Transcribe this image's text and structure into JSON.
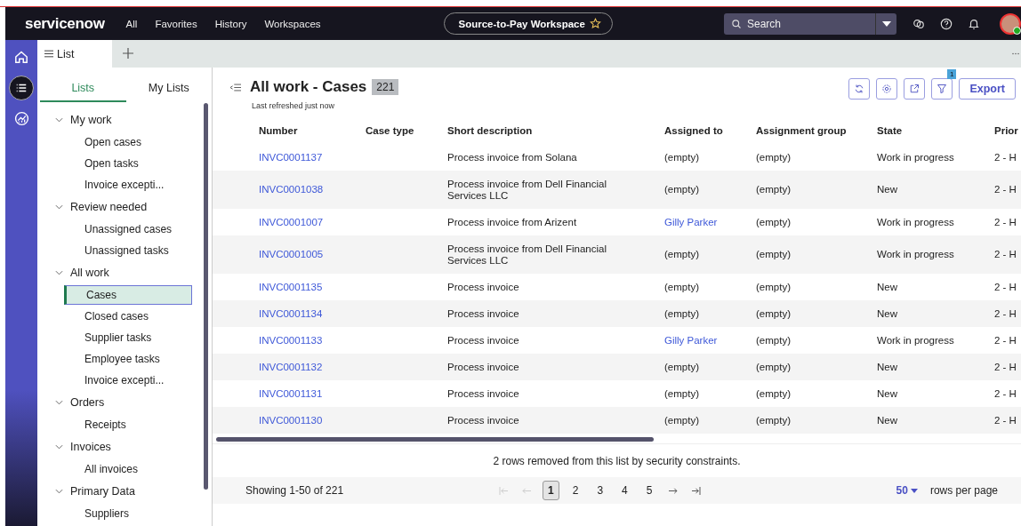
{
  "header": {
    "logo": "servicenow",
    "nav": [
      "All",
      "Favorites",
      "History",
      "Workspaces"
    ],
    "workspace": "Source-to-Pay Workspace",
    "search": {
      "placeholder": "Search"
    }
  },
  "page_tabs": [
    {
      "label": "List",
      "selected": true
    }
  ],
  "panel": {
    "tabs": [
      {
        "label": "Lists",
        "selected": true
      },
      {
        "label": "My Lists",
        "selected": false
      }
    ],
    "groups": [
      {
        "label": "My work",
        "expanded": true,
        "children": [
          {
            "label": "Open cases",
            "selected": false
          },
          {
            "label": "Open tasks",
            "selected": false
          },
          {
            "label": "Invoice excepti...",
            "selected": false
          }
        ]
      },
      {
        "label": "Review needed",
        "expanded": true,
        "children": [
          {
            "label": "Unassigned cases",
            "selected": false
          },
          {
            "label": "Unassigned tasks",
            "selected": false
          }
        ]
      },
      {
        "label": "All work",
        "expanded": true,
        "children": [
          {
            "label": "Cases",
            "selected": true
          },
          {
            "label": "Closed cases",
            "selected": false
          },
          {
            "label": "Supplier tasks",
            "selected": false
          },
          {
            "label": "Employee tasks",
            "selected": false
          },
          {
            "label": "Invoice excepti...",
            "selected": false
          }
        ]
      },
      {
        "label": "Orders",
        "expanded": true,
        "children": [
          {
            "label": "Receipts",
            "selected": false
          }
        ]
      },
      {
        "label": "Invoices",
        "expanded": true,
        "children": [
          {
            "label": "All invoices",
            "selected": false
          }
        ]
      },
      {
        "label": "Primary Data",
        "expanded": true,
        "children": [
          {
            "label": "Suppliers",
            "selected": false
          }
        ]
      }
    ]
  },
  "list": {
    "title": "All work - Cases",
    "count": "221",
    "refreshed": "Last refreshed just now",
    "filter_badge": "1",
    "export": "Export",
    "columns": [
      "Number",
      "Case type",
      "Short description",
      "Assigned to",
      "Assignment group",
      "State",
      "Prior"
    ],
    "rows": [
      {
        "number": "INVC0001137",
        "case_type": "",
        "description": "Process invoice from Solana",
        "assigned_to": "(empty)",
        "assigned_link": false,
        "group": "(empty)",
        "state": "Work in progress",
        "priority": "2 - H"
      },
      {
        "number": "INVC0001038",
        "case_type": "",
        "description": "Process invoice from Dell Financial Services LLC",
        "assigned_to": "(empty)",
        "assigned_link": false,
        "group": "(empty)",
        "state": "New",
        "priority": "2 - H"
      },
      {
        "number": "INVC0001007",
        "case_type": "",
        "description": "Process invoice from Arizent",
        "assigned_to": "Gilly Parker",
        "assigned_link": true,
        "group": "(empty)",
        "state": "Work in progress",
        "priority": "2 - H"
      },
      {
        "number": "INVC0001005",
        "case_type": "",
        "description": "Process invoice from Dell Financial Services LLC",
        "assigned_to": "(empty)",
        "assigned_link": false,
        "group": "(empty)",
        "state": "Work in progress",
        "priority": "2 - H"
      },
      {
        "number": "INVC0001135",
        "case_type": "",
        "description": "Process invoice",
        "assigned_to": "(empty)",
        "assigned_link": false,
        "group": "(empty)",
        "state": "New",
        "priority": "2 - H"
      },
      {
        "number": "INVC0001134",
        "case_type": "",
        "description": "Process invoice",
        "assigned_to": "(empty)",
        "assigned_link": false,
        "group": "(empty)",
        "state": "New",
        "priority": "2 - H"
      },
      {
        "number": "INVC0001133",
        "case_type": "",
        "description": "Process invoice",
        "assigned_to": "Gilly Parker",
        "assigned_link": true,
        "group": "(empty)",
        "state": "Work in progress",
        "priority": "2 - H"
      },
      {
        "number": "INVC0001132",
        "case_type": "",
        "description": "Process invoice",
        "assigned_to": "(empty)",
        "assigned_link": false,
        "group": "(empty)",
        "state": "New",
        "priority": "2 - H"
      },
      {
        "number": "INVC0001131",
        "case_type": "",
        "description": "Process invoice",
        "assigned_to": "(empty)",
        "assigned_link": false,
        "group": "(empty)",
        "state": "New",
        "priority": "2 - H"
      },
      {
        "number": "INVC0001130",
        "case_type": "",
        "description": "Process invoice",
        "assigned_to": "(empty)",
        "assigned_link": false,
        "group": "(empty)",
        "state": "New",
        "priority": "2 - H"
      }
    ],
    "notice": "2 rows removed from this list by security constraints.",
    "showing": "Showing 1-50 of 221",
    "pages": [
      {
        "label": "1",
        "selected": true
      },
      {
        "label": "2",
        "selected": false
      },
      {
        "label": "3",
        "selected": false
      },
      {
        "label": "4",
        "selected": false
      },
      {
        "label": "5",
        "selected": false
      }
    ],
    "per_page": "50",
    "per_page_label": "rows per page"
  }
}
